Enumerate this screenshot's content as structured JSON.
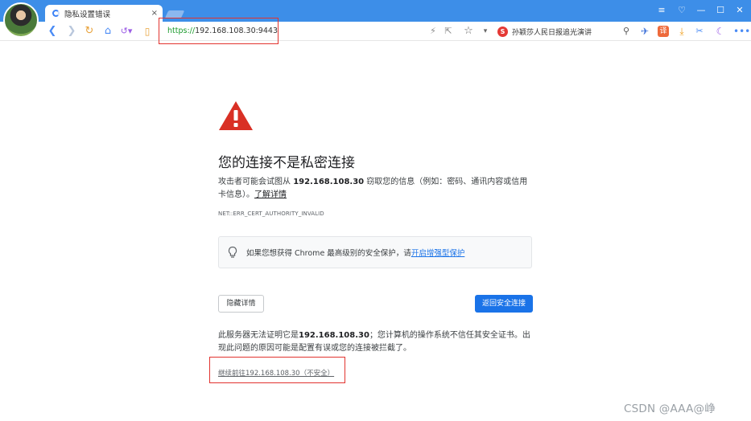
{
  "tab": {
    "title": "隐私设置错误",
    "close": "×"
  },
  "window_controls": {
    "menu": "≡",
    "skin": "♡",
    "minimize": "—",
    "maximize": "☐",
    "close": "✕"
  },
  "address_bar": {
    "scheme": "https://",
    "host": "192.168.108.30",
    "port": ":9443"
  },
  "search": {
    "badge": "S",
    "text": "孙颖莎人民日报追光演讲"
  },
  "colors": {
    "titlebar": "#3d8ee8",
    "highlight": "#e2332f",
    "warning": "#d93025",
    "primary": "#1a73e8"
  },
  "icons": [
    "back-icon",
    "forward-icon",
    "reload-icon",
    "home-icon",
    "history-icon",
    "reader-icon",
    "bolt-icon",
    "share-icon",
    "star-icon",
    "dropdown-icon",
    "search-icon",
    "extension-icons",
    "more-icon",
    "bulb-icon",
    "warning-icon"
  ],
  "page": {
    "heading": "您的连接不是私密连接",
    "desc_pre": "攻击者可能会试图从 ",
    "desc_host": "192.168.108.30",
    "desc_post": " 窃取您的信息（例如：密码、通讯内容或信用卡信息）。",
    "learn_more": "了解详情",
    "error_code": "NET::ERR_CERT_AUTHORITY_INVALID",
    "promo_pre": "如果您想获得 Chrome 最高级别的安全保护，请",
    "promo_link": "开启增强型保护",
    "details_button": "隐藏详情",
    "back_button": "返回安全连接",
    "detail_pre": "此服务器无法证明它是",
    "detail_host": "192.168.108.30",
    "detail_post": "；您计算机的操作系统不信任其安全证书。出现此问题的原因可能是配置有误或您的连接被拦截了。",
    "proceed_link": "继续前往192.168.108.30（不安全）"
  },
  "watermark": "CSDN @AAA@峥"
}
